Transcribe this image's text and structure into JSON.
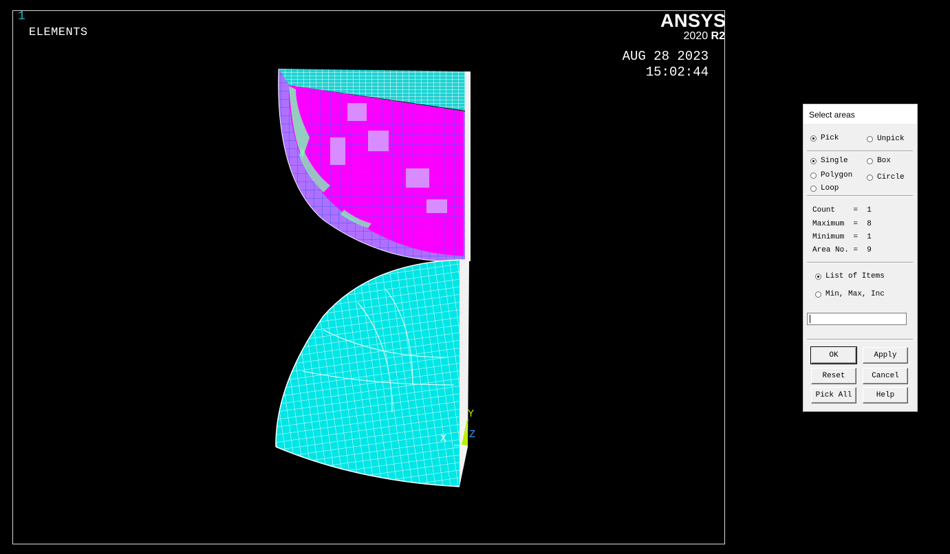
{
  "graphics": {
    "window_number": "1",
    "plot_title": "ELEMENTS",
    "brand": {
      "name": "ANSYS",
      "version_year": "2020",
      "version_release": "R2"
    },
    "date": "AUG 28 2023",
    "time": "15:02:44",
    "triad": {
      "x": "X",
      "y": "Y",
      "z": "Z"
    },
    "colors": {
      "background": "#000000",
      "mesh_fill": "#00e5e5",
      "selected_fill": "#ff00ff",
      "mesh_lines": "#3a5aff",
      "triad_y": "#b8f000",
      "triad_z": "#28a8ff"
    }
  },
  "dialog": {
    "title": "Select areas",
    "pick": "Pick",
    "unpick": "Unpick",
    "single": "Single",
    "box": "Box",
    "polygon": "Polygon",
    "circle": "Circle",
    "loop": "Loop",
    "count_label": "Count    =  1",
    "maximum_label": "Maximum  =  8",
    "minimum_label": "Minimum  =  1",
    "area_no_label": "Area No. =  9",
    "list_of_items": "List of Items",
    "min_max_inc": "Min, Max, Inc",
    "input_value": "",
    "buttons": {
      "ok": "OK",
      "apply": "Apply",
      "reset": "Reset",
      "cancel": "Cancel",
      "pick_all": "Pick All",
      "help": "Help"
    }
  }
}
